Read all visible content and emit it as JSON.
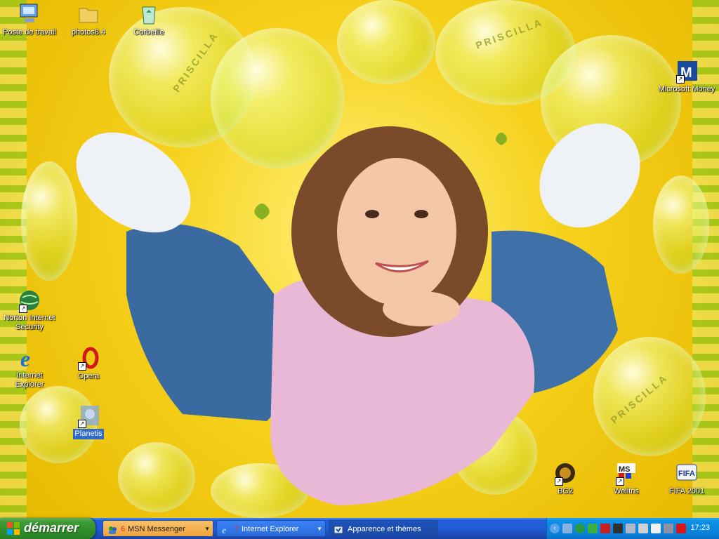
{
  "desktop": {
    "wallpaper_text": "PRISCILLA",
    "icons": [
      {
        "name": "desktop-icon-poste-de-travail",
        "label": "Poste de travail"
      },
      {
        "name": "desktop-icon-photos",
        "label": "photos8.4"
      },
      {
        "name": "desktop-icon-corbeille",
        "label": "Corbeille"
      },
      {
        "name": "desktop-icon-microsoft-money",
        "label": "Microsoft Money"
      },
      {
        "name": "desktop-icon-norton",
        "label": "Norton Internet Security"
      },
      {
        "name": "desktop-icon-internet-explorer",
        "label": "Internet Explorer"
      },
      {
        "name": "desktop-icon-opera",
        "label": "Opera"
      },
      {
        "name": "desktop-icon-planetis",
        "label": "Planetis"
      },
      {
        "name": "desktop-icon-bg2",
        "label": "BG2"
      },
      {
        "name": "desktop-icon-welltris",
        "label": "Welltris"
      },
      {
        "name": "desktop-icon-fifa",
        "label": "FIFA 2001"
      }
    ]
  },
  "taskbar": {
    "start_label": "démarrer",
    "tasks": [
      {
        "count": "6",
        "label": "MSN Messenger"
      },
      {
        "count": "7",
        "label": "Internet Explorer"
      },
      {
        "count": "",
        "label": "Apparence et thèmes"
      }
    ],
    "tray": {
      "clock": "17:23",
      "icons": [
        "chevron-left-icon",
        "network-icon",
        "globe-icon",
        "messenger-icon",
        "ati-icon",
        "isdn-icon",
        "keyboard-icon",
        "font-icon",
        "text-icon",
        "volume-icon",
        "antivirus-icon"
      ]
    }
  },
  "colors": {
    "taskbar_blue": "#245edb",
    "start_green": "#3c9c36",
    "tray_blue": "#0b7fd8",
    "wallpaper_yellow": "#f6d11c"
  }
}
